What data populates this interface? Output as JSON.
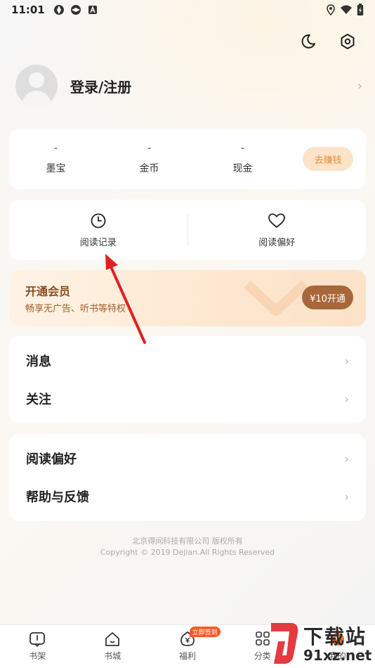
{
  "status_bar": {
    "time": "11:01"
  },
  "profile": {
    "login_label": "登录/注册"
  },
  "wallet": {
    "stats": [
      {
        "value": "-",
        "label": "墨宝"
      },
      {
        "value": "-",
        "label": "金币"
      },
      {
        "value": "-",
        "label": "现金"
      }
    ],
    "earn_label": "去赚钱"
  },
  "shortcuts": [
    {
      "label": "阅读记录",
      "icon": "clock-icon"
    },
    {
      "label": "阅读偏好",
      "icon": "heart-icon"
    }
  ],
  "vip": {
    "title": "开通会员",
    "subtitle": "畅享无广告、听书等特权",
    "button": "¥10开通"
  },
  "menu_group_1": [
    {
      "label": "消息"
    },
    {
      "label": "关注"
    }
  ],
  "menu_group_2": [
    {
      "label": "阅读偏好"
    },
    {
      "label": "帮助与反馈"
    }
  ],
  "footer": {
    "line1": "北京得间科技有限公司 版权所有",
    "line2": "Copyright © 2019 Dejian.All Rights Reserved"
  },
  "tabbar": {
    "tabs": [
      {
        "label": "书架",
        "icon": "bookshelf-icon"
      },
      {
        "label": "书城",
        "icon": "bookstore-icon"
      },
      {
        "label": "福利",
        "icon": "welfare-icon",
        "badge": "立即签到"
      },
      {
        "label": "分类",
        "icon": "category-icon"
      },
      {
        "label": "我的",
        "icon": "profile-icon"
      }
    ]
  },
  "watermark": {
    "text_large": "下载站",
    "text_small": "91xz.net"
  },
  "colors": {
    "accent": "#e68a3a",
    "vip_button": "#a8673a",
    "annotation_arrow": "#e02020"
  }
}
